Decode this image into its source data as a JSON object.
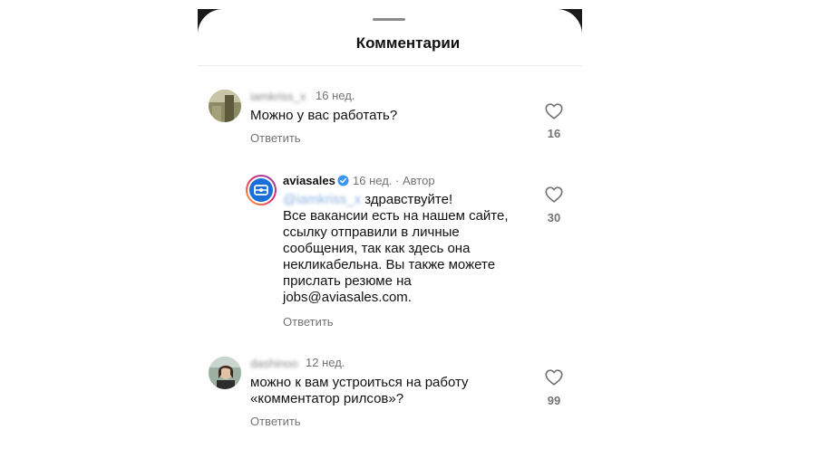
{
  "header": {
    "title": "Комментарии"
  },
  "comments": [
    {
      "username": "iamkriss_x",
      "time": "16 нед.",
      "text": "Можно у вас работать?",
      "reply_label": "Ответить",
      "likes": "16",
      "like_icon": "heart-outline"
    },
    {
      "username": "aviasales",
      "time": "16 нед.",
      "separator": "·",
      "badge": "Автор",
      "verified": true,
      "mention": "@iamkriss_x",
      "greeting": " здравствуйте!",
      "lines": [
        "Все вакансии есть на нашем сайте,",
        "ссылку отправили в личные",
        "сообщения, так как здесь она",
        "некликабельна. Вы также можете",
        "прислать резюме на",
        "jobs@aviasales.com."
      ],
      "reply_label": "Ответить",
      "likes": "30",
      "like_icon": "heart-outline",
      "brand_color": "#1a6fd8"
    },
    {
      "username": "dashinoo",
      "time": "12 нед.",
      "lines": [
        "можно к вам устроиться на работу",
        "«комментатор рилсов»?"
      ],
      "reply_label": "Ответить",
      "likes": "99",
      "like_icon": "heart-outline"
    }
  ]
}
